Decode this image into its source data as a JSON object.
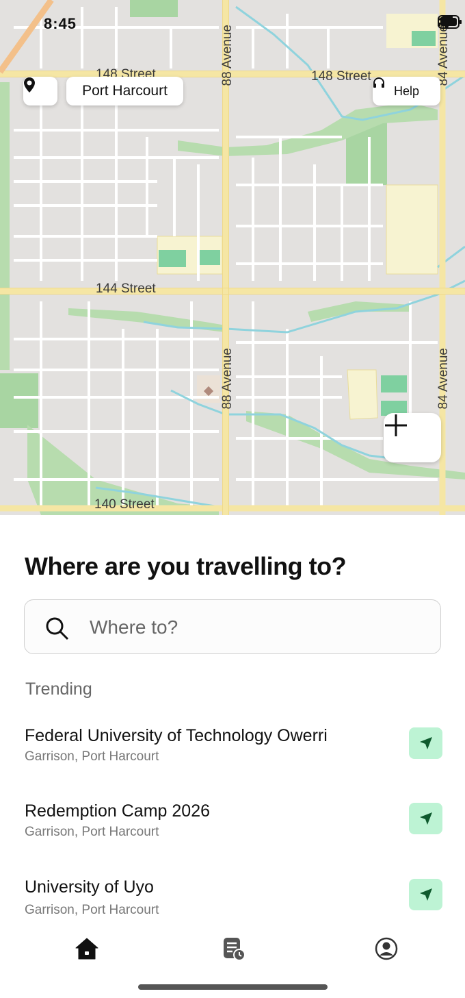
{
  "status_bar": {
    "time": "8:45"
  },
  "map": {
    "location_chip": "Port Harcourt",
    "help_label": "Help",
    "streets": {
      "s148_left": "148 Street",
      "s148_right": "148 Street",
      "s144": "144 Street",
      "s140": "140 Street",
      "ave88_top": "88 Avenue",
      "ave88_bottom": "88 Avenue",
      "ave84_top": "84 Avenue",
      "ave84_bottom": "84 Avenue"
    }
  },
  "main": {
    "heading": "Where are you travelling to?",
    "search_placeholder": "Where to?",
    "trending_label": "Trending",
    "trending": [
      {
        "title": "Federal University of Technology Owerri",
        "subtitle": "Garrison, Port Harcourt"
      },
      {
        "title": "Redemption Camp 2026",
        "subtitle": "Garrison, Port Harcourt"
      },
      {
        "title": "University of Uyo",
        "subtitle": "Garrison, Port Harcourt"
      }
    ]
  },
  "tabs": [
    "home-icon",
    "bookings-history-icon",
    "profile-icon"
  ],
  "colors": {
    "accent_bg": "#bdf3d4",
    "accent_icon": "#0f5a2e",
    "road": "#f5e6a4",
    "park": "#a8d5a2",
    "water": "#8fd3dd"
  }
}
